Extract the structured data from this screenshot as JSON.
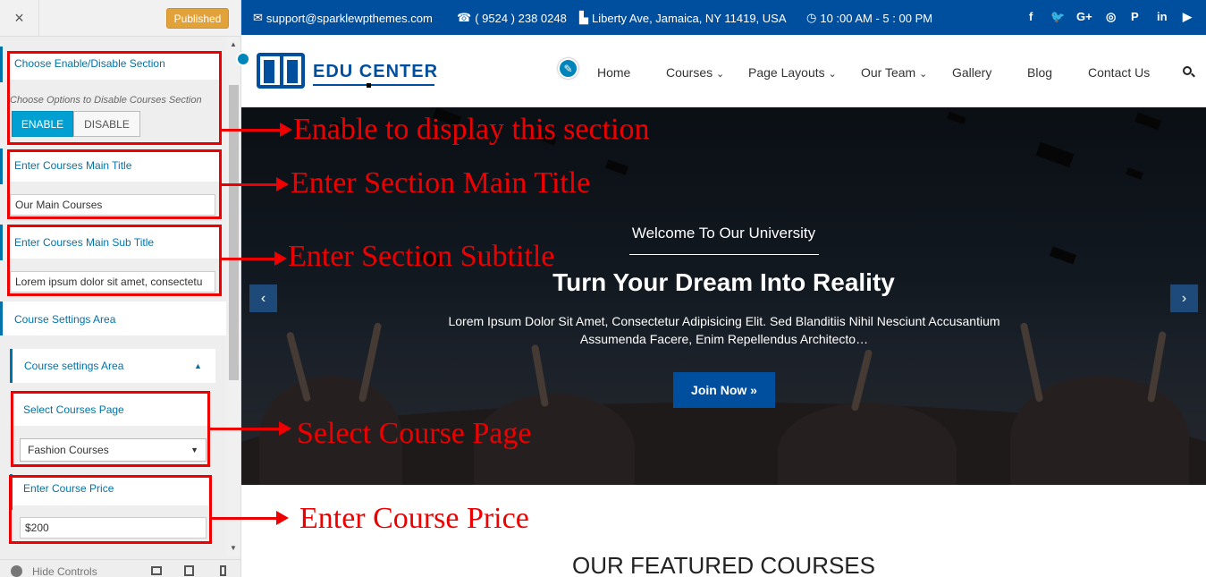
{
  "panel": {
    "close_icon": "×",
    "publish_label": "Published",
    "enable_section": {
      "label": "Choose Enable/Disable Section",
      "description": "Choose Options to Disable Courses Section",
      "enable_label": "ENABLE",
      "disable_label": "DISABLE",
      "selected": "ENABLE"
    },
    "main_title": {
      "label": "Enter Courses Main Title",
      "value": "Our Main Courses"
    },
    "sub_title": {
      "label": "Enter Courses Main Sub Title",
      "value": "Lorem ipsum dolor sit amet, consectetu"
    },
    "settings_area": {
      "label": "Course Settings Area"
    },
    "settings_group": {
      "label": "Course settings Area",
      "collapse_icon": "▲"
    },
    "course_page": {
      "label": "Select Courses Page",
      "value": "Fashion Courses",
      "caret": "▼"
    },
    "course_price": {
      "label": "Enter Course Price",
      "value": "$200"
    },
    "footer": {
      "hide_label": "Hide Controls"
    }
  },
  "site": {
    "topbar": {
      "email": "support@sparklewpthemes.com",
      "phone": "( 9524 ) 238 0248",
      "address": "Liberty Ave, Jamaica, NY 11419, USA",
      "hours": "10 :00 AM - 5 : 00 PM",
      "social_icons": [
        "f",
        "🐦",
        "G+",
        "◎",
        "P",
        "in",
        "▶"
      ]
    },
    "logo": {
      "text": "EDU CENTER"
    },
    "nav": [
      {
        "label": "Home"
      },
      {
        "label": "Courses",
        "caret": "⌄"
      },
      {
        "label": "Page Layouts",
        "caret": "⌄"
      },
      {
        "label": "Our Team",
        "caret": "⌄"
      },
      {
        "label": "Gallery"
      },
      {
        "label": "Blog"
      },
      {
        "label": "Contact Us"
      }
    ],
    "hero": {
      "welcome": "Welcome To Our University",
      "title": "Turn Your Dream Into Reality",
      "description": "Lorem Ipsum Dolor Sit Amet, Consectetur Adipisicing Elit. Sed Blanditiis Nihil Nesciunt Accusantium Assumenda Facere, Enim Repellendus Architecto…",
      "button": "Join Now »",
      "prev": "‹",
      "next": "›"
    },
    "featured_heading": "OUR FEATURED COURSES"
  },
  "annotations": [
    "Enable to display this section",
    "Enter Section Main Title",
    "Enter Section Subtitle",
    "Select Course Page",
    "Enter Course Price"
  ],
  "colors": {
    "brand_blue": "#004f9f",
    "wp_blue": "#0073aa",
    "enable_active": "#00a0d2",
    "publish": "#e2a23a",
    "annotation_red": "#ee0000"
  }
}
